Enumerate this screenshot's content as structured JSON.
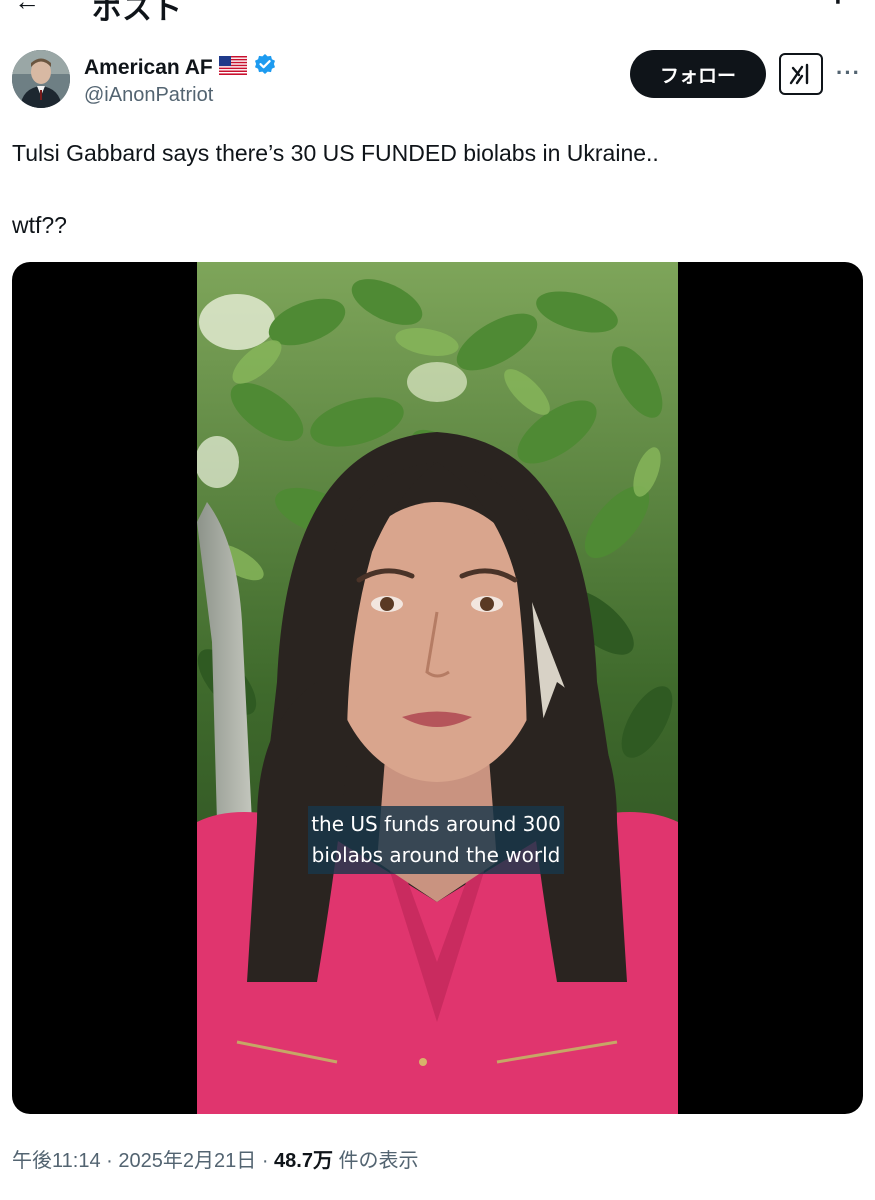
{
  "header": {
    "back_icon": "back-arrow-icon",
    "title": "ポスト"
  },
  "author": {
    "display_name": "American AF",
    "flag": "🇺🇸",
    "verified_icon": "verified-badge-icon",
    "handle": "@iAnonPatriot"
  },
  "actions": {
    "follow_label": "フォロー",
    "grok_icon": "grok-icon",
    "more_icon": "more-options-icon"
  },
  "tweet": {
    "line1": "Tulsi Gabbard says there’s 30 US FUNDED biolabs in Ukraine..",
    "line2": "wtf??"
  },
  "media": {
    "caption_line1": "the US funds around 300",
    "caption_line2": "biolabs around the world"
  },
  "meta": {
    "time": "午後11:14",
    "separator": "·",
    "date": "2025年2月21日",
    "views_count": "48.7万",
    "views_label": "件の表示"
  },
  "colors": {
    "text_primary": "#0f1419",
    "text_secondary": "#536471",
    "verified": "#1d9bf0",
    "caption_bg": "#19374b",
    "shirt": "#e0356e"
  }
}
